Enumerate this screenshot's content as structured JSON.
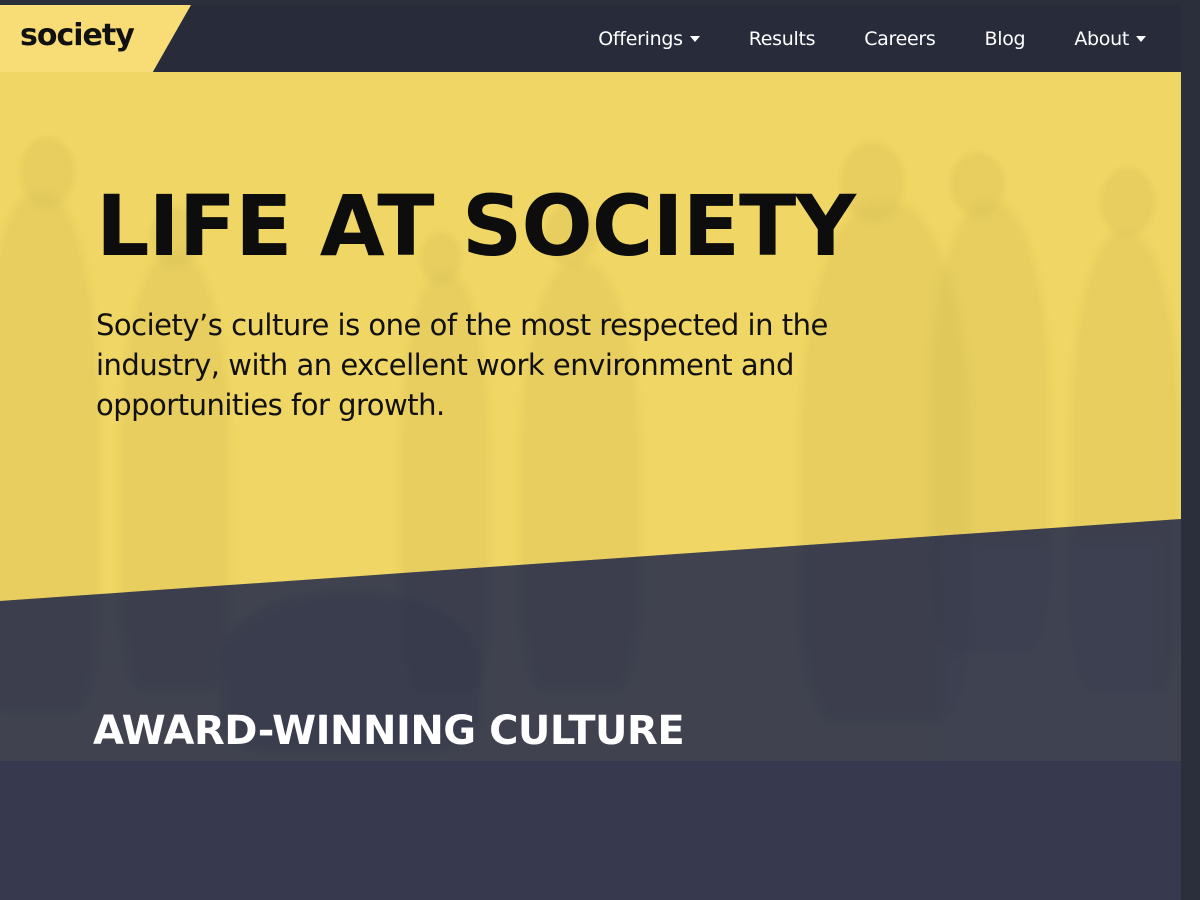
{
  "brand": {
    "logo_text": "society",
    "accent_color": "#f8dd76",
    "nav_color": "#272b3a",
    "dark_section_color": "#373a4f"
  },
  "nav": {
    "items": [
      {
        "label": "Offerings",
        "has_dropdown": true
      },
      {
        "label": "Results",
        "has_dropdown": false
      },
      {
        "label": "Careers",
        "has_dropdown": false
      },
      {
        "label": "Blog",
        "has_dropdown": false
      },
      {
        "label": "About",
        "has_dropdown": true
      }
    ]
  },
  "hero": {
    "title": "LIFE AT SOCIETY",
    "text": "Society’s culture is one of the most respected in the industry, with an excellent work environment and opportunities for growth."
  },
  "section": {
    "heading": "AWARD-WINNING CULTURE"
  }
}
